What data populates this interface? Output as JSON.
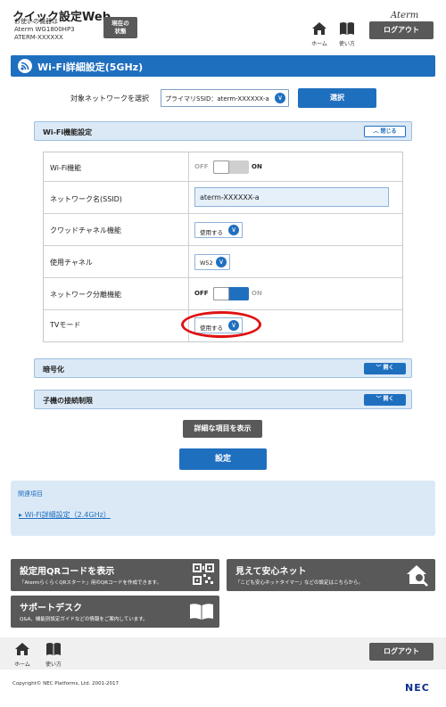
{
  "header": {
    "app_title": "クイック設定Web",
    "device_label": "お使いの機器は",
    "device_model": "Aterm WG1800HP3",
    "device_ssid": "ATERM-XXXXXX",
    "current_status_line1": "現在の",
    "current_status_line2": "状態",
    "brand": "Aterm",
    "home_label": "ホーム",
    "help_label": "使い方",
    "logout_label": "ログアウト"
  },
  "page": {
    "title": "Wi-Fi詳細設定(5GHz)",
    "network_label": "対象ネットワークを選択",
    "network_value": "プライマリSSID：aterm-XXXXXX-a",
    "select_button": "選択"
  },
  "wifi_section": {
    "title": "Wi-Fi機能設定",
    "toggle_label": "閉じる",
    "rows": {
      "wifi_function": {
        "label": "Wi-Fi機能",
        "off": "OFF",
        "on": "ON",
        "state": "ON"
      },
      "ssid": {
        "label": "ネットワーク名(SSID)",
        "value": "aterm-XXXXXX-a"
      },
      "crowded_channel": {
        "label": "クワッドチャネル機能",
        "value": "使用する"
      },
      "channel": {
        "label": "使用チャネル",
        "value": "W52"
      },
      "network_separation": {
        "label": "ネットワーク分離機能",
        "off": "OFF",
        "on": "ON",
        "state": "OFF"
      },
      "tv_mode": {
        "label": "TVモード",
        "value": "使用する"
      }
    }
  },
  "encryption_section": {
    "title": "暗号化",
    "toggle_label": "開く"
  },
  "client_limit_section": {
    "title": "子機の接続制限",
    "toggle_label": "開く"
  },
  "actions": {
    "show_detail": "詳細な項目を表示",
    "apply": "設定"
  },
  "related": {
    "heading": "関連項目",
    "link": "Wi-Fi詳細設定（2.4GHz）"
  },
  "tiles": {
    "qr": {
      "title": "設定用QRコードを表示",
      "sub": "「AtermらくらくQRスタート」用のQRコードを作成できます。"
    },
    "safety": {
      "title": "見えて安心ネット",
      "sub": "「こども安心ネットタイマー」などの設定はこちらから。"
    },
    "support": {
      "title": "サポートデスク",
      "sub": "Q&A、機能別設定ガイドなどの情報をご案内しています。"
    }
  },
  "footer": {
    "home_label": "ホーム",
    "help_label": "使い方",
    "logout_label": "ログアウト",
    "copyright": "Copyright© NEC Platforms, Ltd. 2001-2017",
    "logo": "NEC"
  },
  "colors": {
    "primary_blue": "#1f6fbf",
    "section_bg": "#dbe9f6",
    "dark_button": "#595959",
    "highlight_red": "#e01212"
  }
}
